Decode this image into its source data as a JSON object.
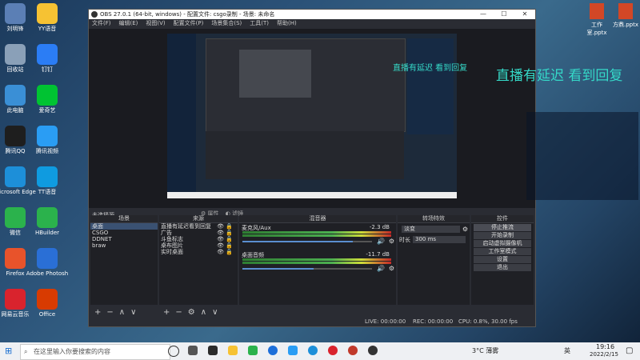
{
  "desktop": {
    "left_icons": [
      {
        "label": "刘明锋",
        "color": "#5b7fb5"
      },
      {
        "label": "回收站",
        "color": "#8aa0b8"
      },
      {
        "label": "此电脑",
        "color": "#3a8fd6"
      },
      {
        "label": "腾讯QQ",
        "color": "#1e1e1e"
      },
      {
        "label": "Microsoft Edge",
        "color": "#1d8fd9"
      },
      {
        "label": "微信",
        "color": "#2bb24c"
      },
      {
        "label": "Firefox",
        "color": "#e8532b"
      },
      {
        "label": "网易云音乐",
        "color": "#d9232d"
      }
    ],
    "second_icons": [
      {
        "label": "YY语音",
        "color": "#f6c233"
      },
      {
        "label": "钉钉",
        "color": "#2b7df5"
      },
      {
        "label": "爱奇艺",
        "color": "#00c332"
      },
      {
        "label": "腾讯视频",
        "color": "#2a9df4"
      },
      {
        "label": "TT语音",
        "color": "#0f9be0"
      },
      {
        "label": "HBuilder",
        "color": "#2bb24c"
      },
      {
        "label": "Adobe Photosh",
        "color": "#2a6fd6"
      },
      {
        "label": "Office",
        "color": "#d83b01"
      }
    ]
  },
  "obs": {
    "title": "OBS 27.0.1 (64-bit, windows) - 配置文件: csgo录制 - 场景: 未命名",
    "menu": [
      "文件(F)",
      "编辑(E)",
      "视图(V)",
      "配置文件(P)",
      "场景集合(S)",
      "工具(T)",
      "帮助(H)"
    ],
    "no_source": "未选择源",
    "toolbar": {
      "props": "属性",
      "filters": "滤镜"
    },
    "docks": {
      "scenes": {
        "title": "场景",
        "items": [
          "桌面",
          "CSGO",
          "DDNET",
          "braw"
        ]
      },
      "sources": {
        "title": "来源",
        "items": [
          "直播有延迟看到回复",
          "广告",
          "斗鱼标志",
          "桌布图片",
          "实时桌面"
        ]
      },
      "mixer": {
        "title": "混音器",
        "channels": [
          {
            "name": "麦克风/Aux",
            "db": "-2.3 dB",
            "level": 0.85
          },
          {
            "name": "桌面音频",
            "db": "-11.7 dB",
            "level": 0.55
          }
        ]
      },
      "transitions": {
        "title": "转场特效",
        "type": "淡变",
        "duration_label": "时长",
        "duration": "300 ms"
      },
      "controls": {
        "title": "控件",
        "buttons": [
          "停止推流",
          "开始录制",
          "启动虚拟摄像机",
          "工作室模式",
          "设置",
          "退出"
        ]
      }
    },
    "status": {
      "live": "LIVE: 00:00:00",
      "rec": "REC: 00:00:00",
      "cpu": "CPU: 0.8%, 30.00 fps"
    }
  },
  "overlay": {
    "caption": "直播有延迟 看到回复",
    "files": [
      "工作室.pptx",
      "方鼎.pptx"
    ]
  },
  "taskbar": {
    "search_placeholder": "在这里输入你要搜索的内容",
    "weather": "3°C 薄雾",
    "ime": "英",
    "time": "19:16",
    "date": "2022/2/15"
  }
}
